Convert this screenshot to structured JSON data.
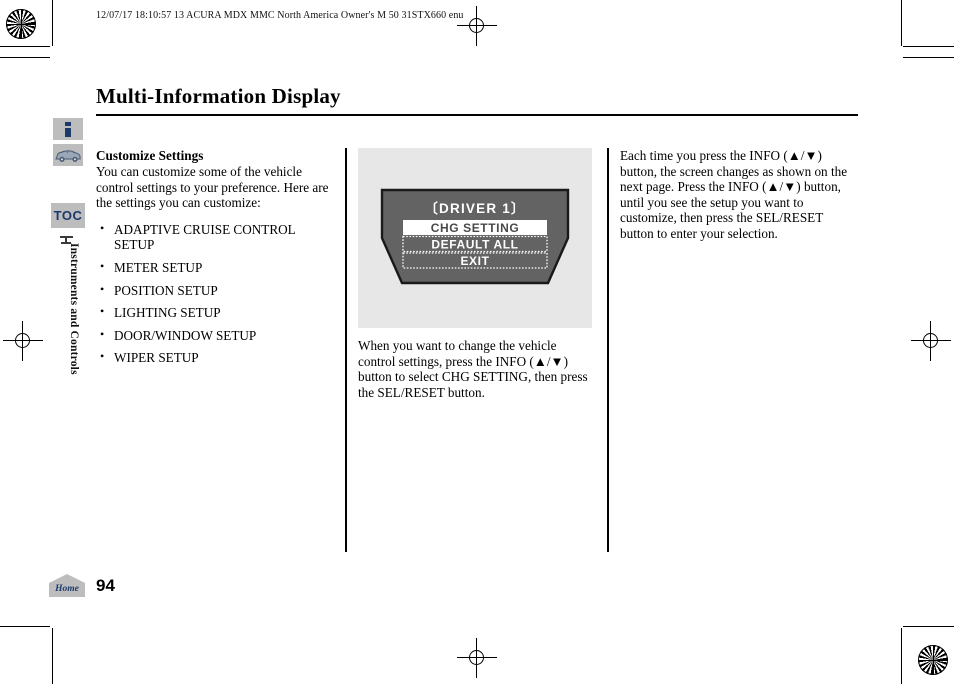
{
  "header": {
    "running_head": "12/07/17 18:10:57   13 ACURA MDX MMC North America Owner's M 50 31STX660 enu"
  },
  "title": "Multi-Information Display",
  "sidebar": {
    "tabs": [
      {
        "name": "info-icon",
        "label": "i"
      },
      {
        "name": "vehicle-icon",
        "label": ""
      },
      {
        "name": "toc-tab",
        "label": "TOC"
      }
    ],
    "section_label": "Instruments and Controls"
  },
  "left_column": {
    "subhead": "Customize Settings",
    "intro": "You can customize some of the vehicle control settings to your preference. Here are the settings you can customize:",
    "bullets": [
      "ADAPTIVE CRUISE CONTROL SETUP",
      "METER SETUP",
      "POSITION SETUP",
      "LIGHTING SETUP",
      "DOOR/WINDOW SETUP",
      "WIPER SETUP"
    ]
  },
  "middle_column": {
    "illustration": {
      "title": "〔DRIVER 1〕",
      "menu_items": [
        {
          "label": "CHG SETTING",
          "selected": true
        },
        {
          "label": "DEFAULT ALL",
          "selected": false
        },
        {
          "label": "EXIT",
          "selected": false
        }
      ],
      "panel_color": "#636363",
      "background_color": "#e7e7e7",
      "highlight_color": "#ffffff"
    },
    "caption": "When you want to change the vehicle control settings, press the INFO (▲/▼) button to select CHG SETTING, then press the SEL/RESET button."
  },
  "right_column": {
    "body": "Each time you press the INFO (▲/▼) button, the screen changes as shown on the next page. Press the INFO (▲/▼) button, until you see the setup you want to customize, then press the SEL/RESET button to enter your selection."
  },
  "footer": {
    "home_label": "Home",
    "page_number": "94"
  }
}
